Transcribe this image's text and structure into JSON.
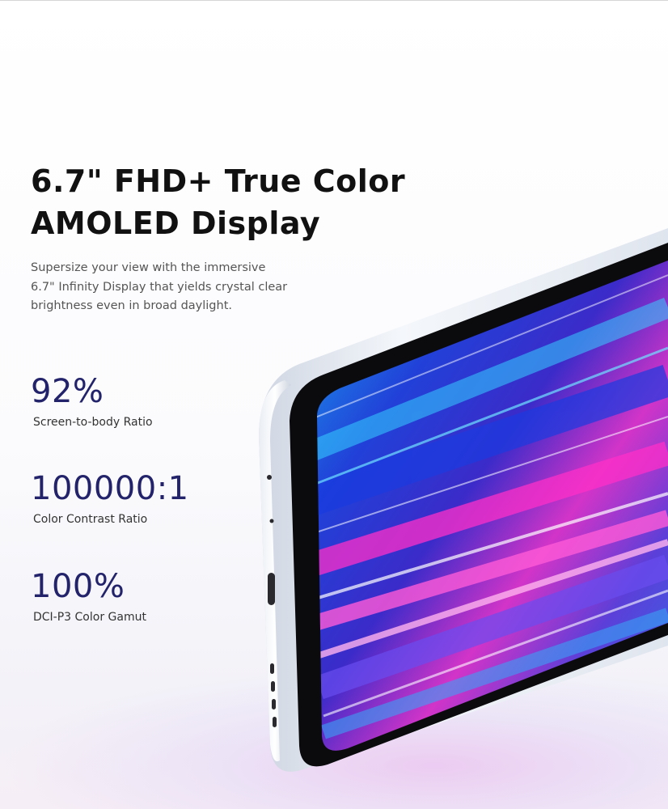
{
  "headline": {
    "line1": "6.7\" FHD+ True Color",
    "line2": "AMOLED Display"
  },
  "description": {
    "line1": "Supersize your view with the immersive",
    "line2": "6.7\" Infinity Display that yields crystal clear",
    "line3": "brightness even in broad daylight."
  },
  "stats": [
    {
      "value": "92%",
      "label": "Screen-to-body Ratio"
    },
    {
      "value": "100000:1",
      "label": "Color Contrast Ratio"
    },
    {
      "value": "100%",
      "label": "DCI-P3 Color Gamut"
    }
  ],
  "colors": {
    "stat_value": "#23236b",
    "headline": "#111111",
    "screen_blue": "#1e4fe0",
    "screen_magenta": "#e23cc8",
    "screen_cyan": "#35b8f0"
  }
}
